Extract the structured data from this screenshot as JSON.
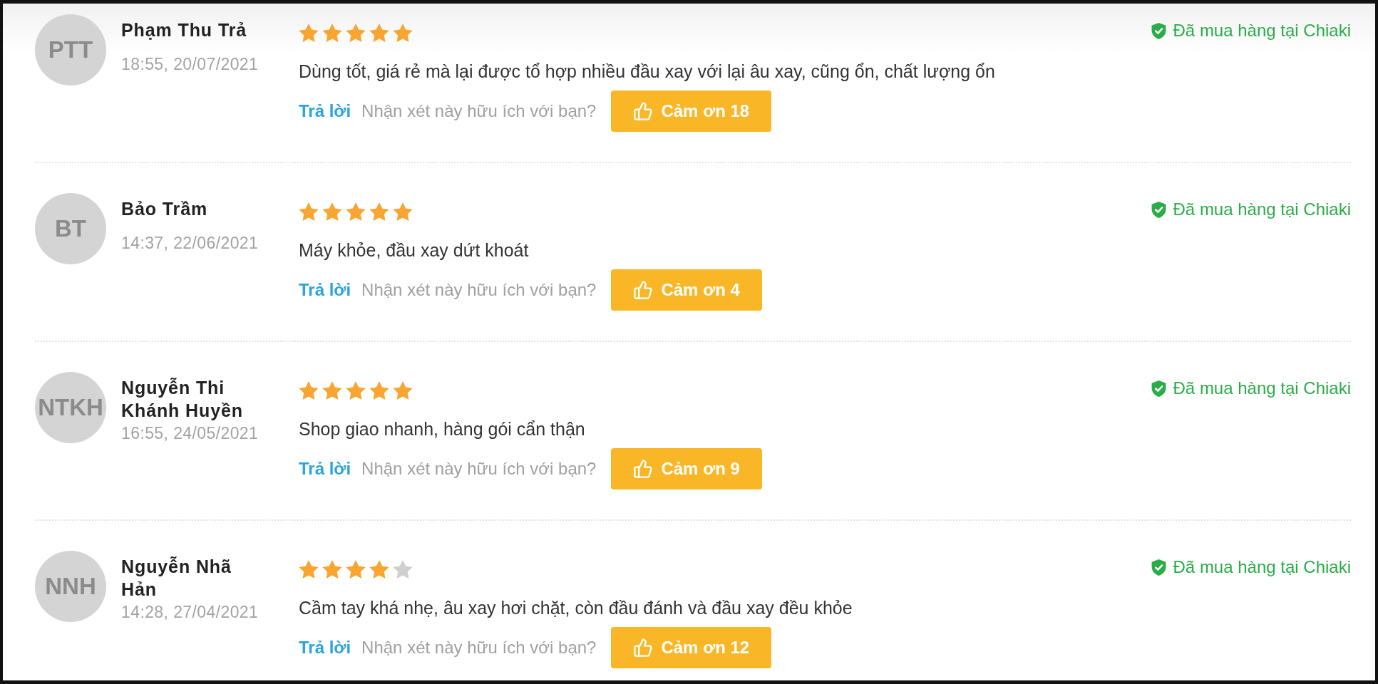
{
  "reviews": [
    {
      "initials": "PTT",
      "name": "Phạm Thu Trả",
      "time": "18:55, 20/07/2021",
      "stars": 5,
      "comment": "Dùng tốt, giá rẻ mà lại được tổ hợp nhiều đầu xay với lại âu xay, cũng ổn, chất lượng ổn",
      "reply_link": "Trả lời",
      "helpful_prompt": "Nhận xét này hữu ích với bạn?",
      "thanks_button": "Cảm ơn 18",
      "badge": "Đã mua hàng tại Chiaki"
    },
    {
      "initials": "BT",
      "name": "Bảo Trầm",
      "time": "14:37, 22/06/2021",
      "stars": 5,
      "comment": "Máy khỏe, đầu xay dứt khoát",
      "reply_link": "Trả lời",
      "helpful_prompt": "Nhận xét này hữu ích với bạn?",
      "thanks_button": "Cảm ơn 4",
      "badge": "Đã mua hàng tại Chiaki"
    },
    {
      "initials": "NTKH",
      "name": "Nguyễn Thi Khánh Huyền",
      "time": "16:55, 24/05/2021",
      "stars": 5,
      "comment": "Shop giao nhanh, hàng gói cẩn thận",
      "reply_link": "Trả lời",
      "helpful_prompt": "Nhận xét này hữu ích với bạn?",
      "thanks_button": "Cảm ơn 9",
      "badge": "Đã mua hàng tại Chiaki"
    },
    {
      "initials": "NNH",
      "name": "Nguyễn Nhã Hản",
      "time": "14:28, 27/04/2021",
      "stars": 4,
      "comment": "Cầm tay khá nhẹ, âu xay hơi chặt, còn đầu đánh và đầu xay đều khỏe",
      "reply_link": "Trả lời",
      "helpful_prompt": "Nhận xét này hữu ích với bạn?",
      "thanks_button": "Cảm ơn 12",
      "badge": "Đã mua hàng tại Chiaki"
    }
  ]
}
